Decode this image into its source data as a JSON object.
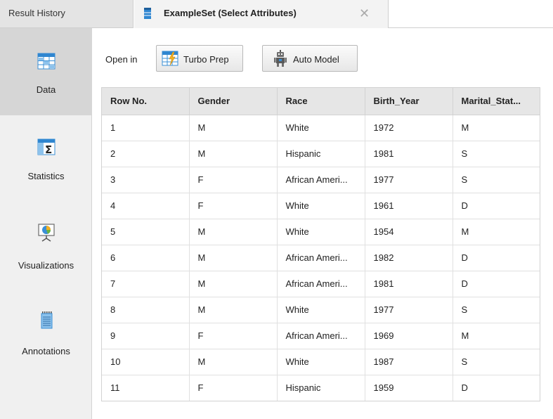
{
  "tabs": {
    "history_label": "Result History",
    "active_label": "ExampleSet (Select Attributes)",
    "close_glyph": "✕"
  },
  "sidebar": {
    "items": [
      {
        "label": "Data",
        "icon": "data-table-icon",
        "active": true
      },
      {
        "label": "Statistics",
        "icon": "statistics-sigma-icon",
        "active": false
      },
      {
        "label": "Visualizations",
        "icon": "visualizations-chart-icon",
        "active": false
      },
      {
        "label": "Annotations",
        "icon": "annotations-notepad-icon",
        "active": false
      }
    ]
  },
  "toolbar": {
    "open_in_label": "Open in",
    "turbo_prep_label": "Turbo Prep",
    "auto_model_label": "Auto Model"
  },
  "table": {
    "columns": [
      "Row No.",
      "Gender",
      "Race",
      "Birth_Year",
      "Marital_Stat..."
    ],
    "rows": [
      [
        "1",
        "M",
        "White",
        "1972",
        "M"
      ],
      [
        "2",
        "M",
        "Hispanic",
        "1981",
        "S"
      ],
      [
        "3",
        "F",
        "African Ameri...",
        "1977",
        "S"
      ],
      [
        "4",
        "F",
        "White",
        "1961",
        "D"
      ],
      [
        "5",
        "M",
        "White",
        "1954",
        "M"
      ],
      [
        "6",
        "M",
        "African Ameri...",
        "1982",
        "D"
      ],
      [
        "7",
        "M",
        "African Ameri...",
        "1981",
        "D"
      ],
      [
        "8",
        "M",
        "White",
        "1977",
        "S"
      ],
      [
        "9",
        "F",
        "African Ameri...",
        "1969",
        "M"
      ],
      [
        "10",
        "M",
        "White",
        "1987",
        "S"
      ],
      [
        "11",
        "F",
        "Hispanic",
        "1959",
        "D"
      ]
    ]
  },
  "colors": {
    "accent_blue": "#3a8fd6",
    "sidebar_bg": "#f0f0f0",
    "sidebar_active_bg": "#d6d6d6",
    "header_bg": "#e6e6e6"
  }
}
